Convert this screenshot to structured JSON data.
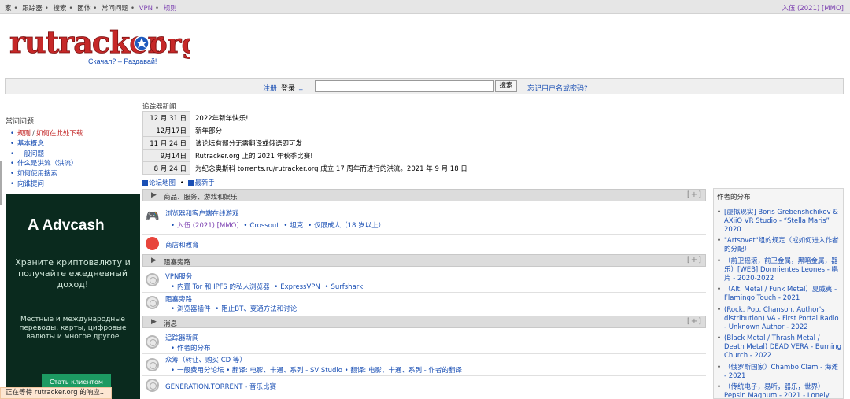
{
  "topbar": {
    "nav": [
      "家",
      "跟踪器",
      "搜索",
      "团体",
      "常问问题",
      "VPN",
      "规则"
    ],
    "user": "入伍 (2021) [MMO]"
  },
  "logo": {
    "text": "rutracker.org",
    "slogan": "Скачал? – Раздавай!"
  },
  "login": {
    "register": "注册",
    "login_label": "登录",
    "underscore": "_",
    "search_button": "搜索",
    "forgot": "忘记用户名或密码?"
  },
  "faq": {
    "title": "常问问题",
    "items": [
      {
        "a": "规则",
        "b": "如何在此处下载"
      },
      {
        "a": "基本概念"
      },
      {
        "a": "一般问题"
      },
      {
        "a": "什么是洪流（洪流）"
      },
      {
        "a": "如何使用搜索"
      },
      {
        "a": "向谁提问"
      }
    ]
  },
  "ad": {
    "brand": "Advcash",
    "line1": "Храните криптовалюту и получайте ежедневный доход!",
    "line2": "Местные и международные переводы, карты, цифровые валюты и многое другое",
    "button": "Стать клиентом"
  },
  "status": "正在等待 rutracker.org 的响应...",
  "news": {
    "title": "追踪器新闻",
    "items": [
      {
        "date": "12 月 31 日",
        "text": "2022年新年快乐!"
      },
      {
        "date": "12月17日",
        "text": "新年部分"
      },
      {
        "date": "11 月 24 日",
        "text": "该论坛有部分无需翻译或俄语即可发"
      },
      {
        "date": "9月14日",
        "text": "Rutracker.org 上的 2021 年秋季比赛!"
      },
      {
        "date": "8 月 24 日",
        "text": "为纪念奥斯科 torrents.ru/rutracker.org 成立 17 周年而进行的洪流。2021 年 9 月 18 日"
      }
    ],
    "subnav": [
      "论坛地图",
      "最新手"
    ]
  },
  "forum": {
    "plus": "[+]",
    "cat1": "商品、服务、游戏和娱乐",
    "f1": {
      "title": "浏览器和客户端在线游戏",
      "s1": "入伍 (2021) [MMO]",
      "s2": "Crossout",
      "s3": "坦克",
      "s4": "仅限成人（18 岁以上）"
    },
    "f2": {
      "title": "商店和教育"
    },
    "cat2": "阻塞旁路",
    "f3": {
      "title": "VPN服务",
      "s1": "内置 Tor 和 IPFS 的私人浏览器",
      "s2": "ExpressVPN",
      "s3": "Surfshark"
    },
    "f4": {
      "title": "阻塞旁路",
      "s1": "浏览器插件",
      "s2": "阻止BT、变通方法和讨论"
    },
    "cat3": "消息",
    "f5": {
      "title": "追踪器新闻",
      "s1": "作者的分布"
    },
    "f6": {
      "title": "众筹（转让、购买 CD 等）",
      "s1": "一般费用分论坛 • 翻译: 电影、卡通、系列 - SV Studio • 翻译: 电影、卡通、系列 - 作者的翻译"
    },
    "f7": {
      "title": "GENERATION.TORRENT - 音乐比赛"
    }
  },
  "right": {
    "title": "作者的分布",
    "items": [
      "[虚拟现实] Boris Grebenshchikov & AXiiO VR Studio - “Stella Maris” 2020",
      "\"Artsovet\"组的规定（或如何进入作者的分配）",
      "（前卫摇滚，前卫金属，黑暗金属，器乐）[WEB] Dormientes Leones - 唱片 - 2020-2022",
      "（Alt. Metal / Funk Metal）夏威夷 - Flamingo Touch - 2021",
      "(Rock, Pop, Chanson, Author's distribution) VA - First Portal Radio - Unknown Author - 2022",
      "(Black Metal / Thrash Metal / Death Metal) DEAD VERA - Burning Church - 2022",
      "（俄罗斯国家）Chambo Clam - 海滩 - 2021",
      "（传统电子，易听，器乐，世界）Pepsin Magnum - 2021 - Lonely"
    ]
  },
  "colors": {
    "link": "#1a4fb4",
    "purple": "#7b3fb0",
    "ad_bg": "#0a2a1e",
    "ad_button": "#1c9a62"
  }
}
